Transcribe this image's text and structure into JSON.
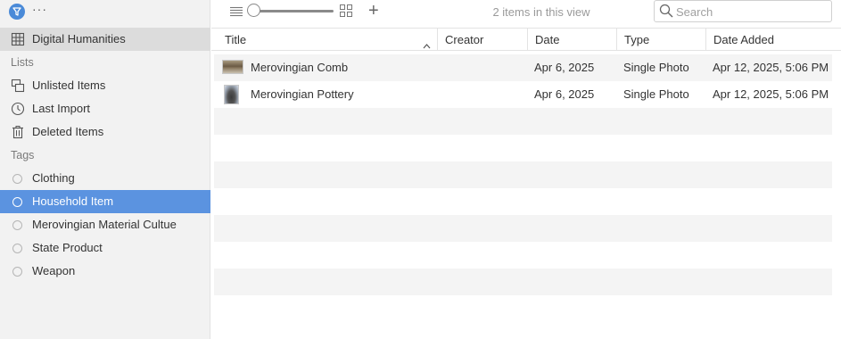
{
  "sidebar": {
    "library": "Digital Humanities",
    "lists_header": "Lists",
    "lists": [
      {
        "label": "Unlisted Items",
        "icon": "unlisted-items-icon"
      },
      {
        "label": "Last Import",
        "icon": "clock-icon"
      },
      {
        "label": "Deleted Items",
        "icon": "trash-icon"
      }
    ],
    "tags_header": "Tags",
    "tags": [
      {
        "label": "Clothing"
      },
      {
        "label": "Household Item",
        "selected": true
      },
      {
        "label": "Merovingian Material Cultue"
      },
      {
        "label": "State Product"
      },
      {
        "label": "Weapon"
      }
    ],
    "more_label": "···"
  },
  "toolbar": {
    "item_count": "2 items in this view",
    "search_placeholder": "Search",
    "add_label": "+"
  },
  "table": {
    "columns": [
      "Title",
      "Creator",
      "Date",
      "Type",
      "Date Added"
    ],
    "rows": [
      {
        "title": "Merovingian Comb",
        "creator": "",
        "date": "Apr 6, 2025",
        "type": "Single Photo",
        "date_added": "Apr 12, 2025, 5:06 PM"
      },
      {
        "title": "Merovingian Pottery",
        "creator": "",
        "date": "Apr 6, 2025",
        "type": "Single Photo",
        "date_added": "Apr 12, 2025, 5:06 PM"
      }
    ]
  },
  "colors": {
    "accent": "#5b93e0",
    "app_icon": "#4a8ad8",
    "sidebar_bg": "#f2f2f2",
    "row_stripe": "#f4f4f4"
  }
}
